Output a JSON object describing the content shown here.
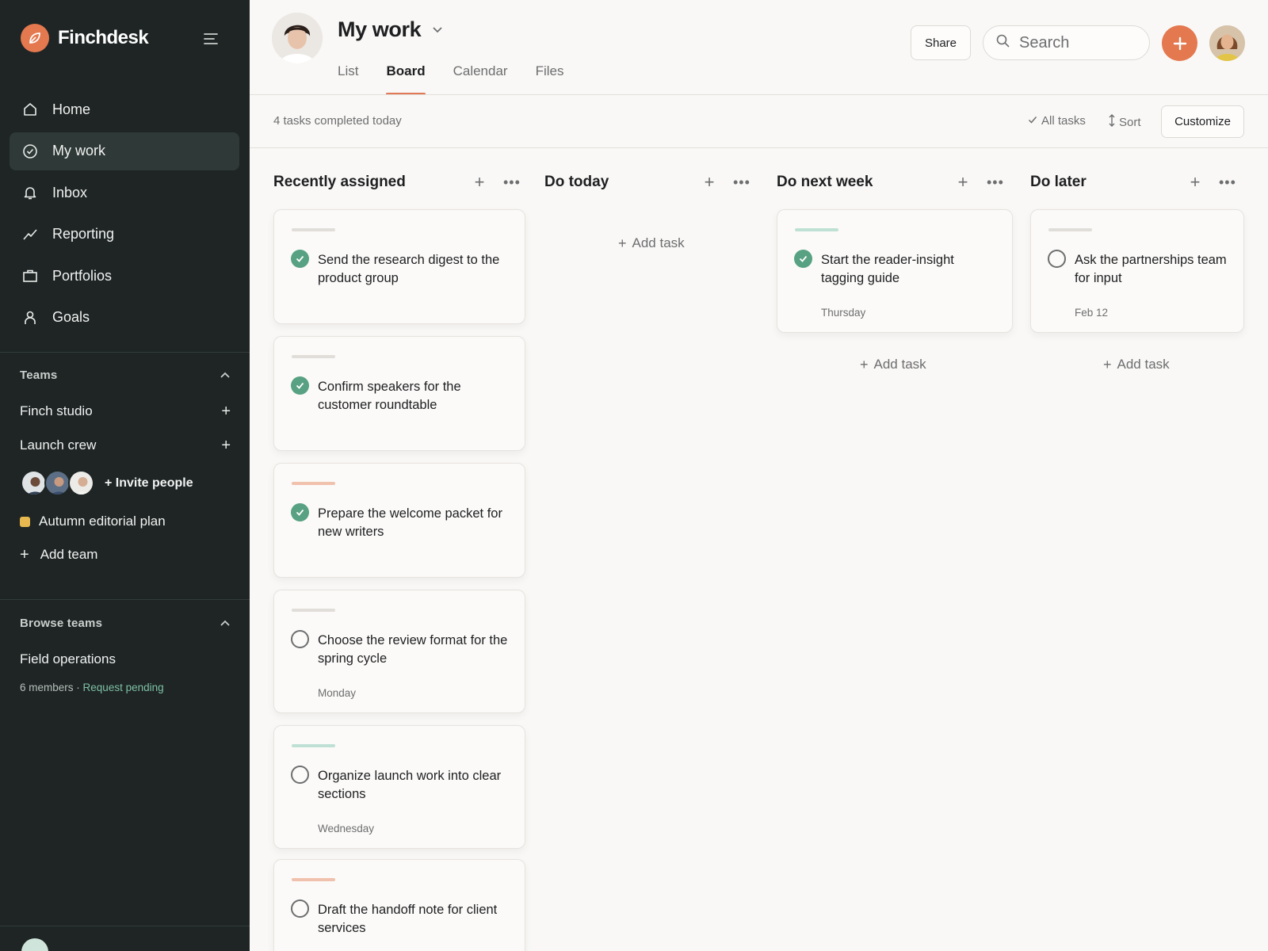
{
  "app": {
    "name": "Finchdesk",
    "accent": "#e4784f"
  },
  "sidebar": {
    "nav": [
      {
        "label": "Home",
        "icon": "home-icon"
      },
      {
        "label": "My work",
        "icon": "check-circle-icon",
        "active": true
      },
      {
        "label": "Inbox",
        "icon": "bell-icon"
      },
      {
        "label": "Reporting",
        "icon": "trend-line-icon"
      },
      {
        "label": "Portfolios",
        "icon": "briefcase-icon"
      },
      {
        "label": "Goals",
        "icon": "person-icon"
      }
    ],
    "teams_header": "Teams",
    "teams": [
      {
        "label": "Finch studio"
      },
      {
        "label": "Launch crew"
      }
    ],
    "invite_label": "+ Invite people",
    "project": {
      "label": "Autumn editorial plan",
      "color": "#e6b84f"
    },
    "add_team_label": "Add team",
    "browse_header": "Browse teams",
    "browse_team": {
      "name": "Field operations",
      "members": "6 members ·",
      "status": "Request pending"
    }
  },
  "header": {
    "title": "My work",
    "tabs": [
      {
        "label": "List"
      },
      {
        "label": "Board",
        "active": true
      },
      {
        "label": "Calendar"
      },
      {
        "label": "Files"
      }
    ],
    "share_label": "Share",
    "search_placeholder": "Search"
  },
  "toolbar": {
    "completed_text": "4 tasks completed today",
    "all_tasks_label": "All tasks",
    "sort_label": "Sort",
    "customize_label": "Customize"
  },
  "board": {
    "add_task_label": "Add task",
    "columns": [
      {
        "title": "Recently assigned",
        "cards": [
          {
            "title": "Send the research digest to the product group",
            "done": true,
            "bar": "#e1deda"
          },
          {
            "title": "Confirm speakers for the customer roundtable",
            "done": true,
            "bar": "#e1deda"
          },
          {
            "title": "Prepare the welcome packet for new writers",
            "done": true,
            "bar": "#f0c1ad"
          },
          {
            "title": "Choose the review format for the spring cycle",
            "done": false,
            "date": "Monday",
            "bar": "#e1deda"
          },
          {
            "title": "Organize launch work into clear sections",
            "done": false,
            "date": "Wednesday",
            "bar": "#bfe1d5"
          },
          {
            "title": "Draft the handoff note for client services",
            "done": false,
            "bar": "#f0c1ad"
          }
        ]
      },
      {
        "title": "Do today",
        "cards": []
      },
      {
        "title": "Do next week",
        "cards": [
          {
            "title": "Start the reader-insight tagging guide",
            "done": true,
            "date": "Thursday",
            "bar": "#bfe1d5"
          }
        ]
      },
      {
        "title": "Do later",
        "cards": [
          {
            "title": "Ask the partnerships team for input",
            "done": false,
            "date": "Feb 12",
            "bar": "#e1deda"
          }
        ]
      }
    ]
  }
}
